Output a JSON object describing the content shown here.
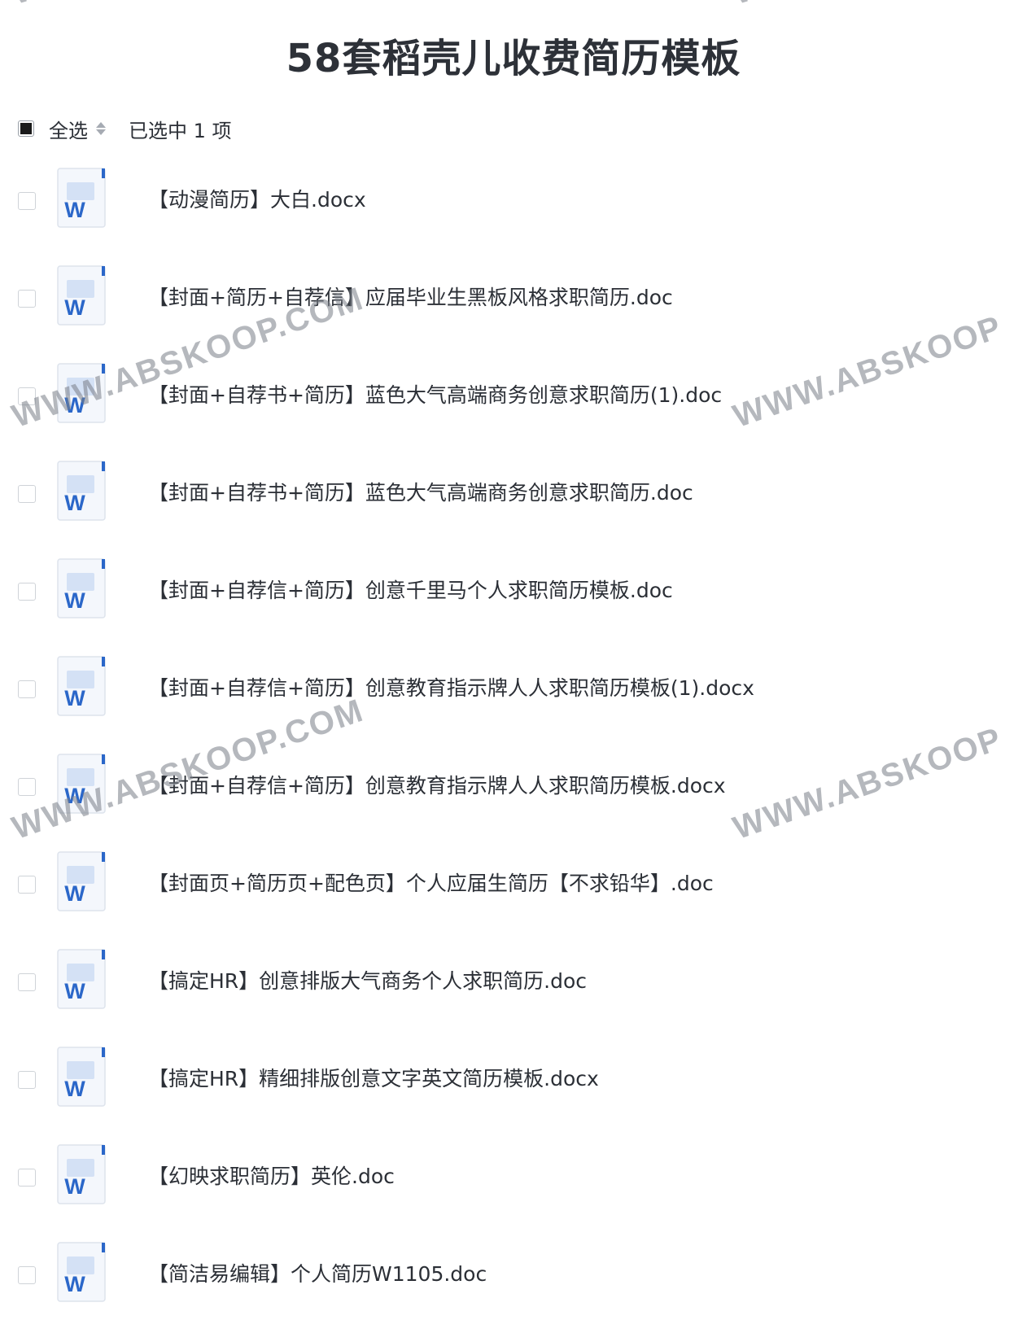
{
  "page": {
    "title": "58套稻壳儿收费简历模板"
  },
  "toolbar": {
    "select_all_label": "全选",
    "selected_count": "已选中 1 项"
  },
  "files": [
    {
      "name": "【动漫简历】大白.docx",
      "icon": "word-doc-icon",
      "checked": false
    },
    {
      "name": "【封面+简历+自荐信】应届毕业生黑板风格求职简历.doc",
      "icon": "word-doc-icon",
      "checked": false
    },
    {
      "name": "【封面+自荐书+简历】蓝色大气高端商务创意求职简历(1).doc",
      "icon": "word-doc-icon",
      "checked": false
    },
    {
      "name": "【封面+自荐书+简历】蓝色大气高端商务创意求职简历.doc",
      "icon": "word-doc-icon",
      "checked": false
    },
    {
      "name": "【封面+自荐信+简历】创意千里马个人求职简历模板.doc",
      "icon": "word-doc-icon",
      "checked": false
    },
    {
      "name": "【封面+自荐信+简历】创意教育指示牌人人求职简历模板(1).docx",
      "icon": "word-doc-icon",
      "checked": false
    },
    {
      "name": "【封面+自荐信+简历】创意教育指示牌人人求职简历模板.docx",
      "icon": "word-doc-icon",
      "checked": false
    },
    {
      "name": "【封面页+简历页+配色页】个人应届生简历【不求铅华】.doc",
      "icon": "word-doc-icon",
      "checked": false
    },
    {
      "name": "【搞定HR】创意排版大气商务个人求职简历.doc",
      "icon": "word-doc-icon",
      "checked": false
    },
    {
      "name": "【搞定HR】精细排版创意文字英文简历模板.docx",
      "icon": "word-doc-icon",
      "checked": false
    },
    {
      "name": "【幻映求职简历】英伦.doc",
      "icon": "word-doc-icon",
      "checked": false
    },
    {
      "name": "【简洁易编辑】个人简历W1105.doc",
      "icon": "word-doc-icon",
      "checked": false
    }
  ],
  "watermark": {
    "text": "WWW.ABSKOOP.COM",
    "text_short": "WWW.ABSKOOP",
    "top_left_fragment": "WW",
    "top_right_fragment": "WW"
  },
  "colors": {
    "word_blue": "#2b67c9",
    "word_light_blue": "#d4e1f5",
    "doc_page": "#f4f7fc"
  }
}
